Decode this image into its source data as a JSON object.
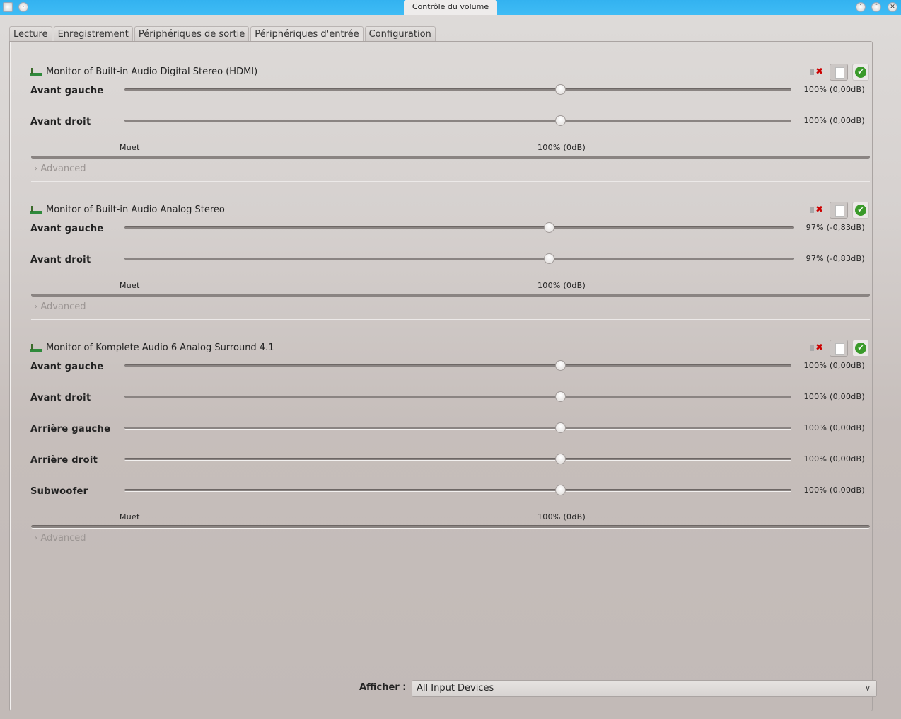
{
  "window": {
    "title": "Contrôle du volume"
  },
  "tabs": [
    {
      "label": "Lecture"
    },
    {
      "label": "Enregistrement"
    },
    {
      "label": "Périphériques de sortie"
    },
    {
      "label": "Périphériques d'entrée",
      "active": true
    },
    {
      "label": "Configuration"
    }
  ],
  "devices": [
    {
      "name": "Monitor of Built-in Audio Digital Stereo (HDMI)",
      "channels": [
        {
          "label": "Avant gauche",
          "percent": 100,
          "value": "100% (0,00dB)"
        },
        {
          "label": "Avant droit",
          "percent": 100,
          "value": "100% (0,00dB)"
        }
      ],
      "scale_min": "Muet",
      "scale_mid": "100% (0dB)",
      "advanced": "Advanced"
    },
    {
      "name": "Monitor of Built-in Audio Analog Stereo",
      "channels": [
        {
          "label": "Avant gauche",
          "percent": 97,
          "value": "97% (-0,83dB)"
        },
        {
          "label": "Avant droit",
          "percent": 97,
          "value": "97% (-0,83dB)"
        }
      ],
      "scale_min": "Muet",
      "scale_mid": "100% (0dB)",
      "advanced": "Advanced"
    },
    {
      "name": "Monitor of Komplete Audio 6 Analog Surround 4.1",
      "channels": [
        {
          "label": "Avant gauche",
          "percent": 100,
          "value": "100% (0,00dB)"
        },
        {
          "label": "Avant droit",
          "percent": 100,
          "value": "100% (0,00dB)"
        },
        {
          "label": "Arrière gauche",
          "percent": 100,
          "value": "100% (0,00dB)"
        },
        {
          "label": "Arrière droit",
          "percent": 100,
          "value": "100% (0,00dB)"
        },
        {
          "label": "Subwoofer",
          "percent": 100,
          "value": "100% (0,00dB)"
        }
      ],
      "scale_min": "Muet",
      "scale_mid": "100% (0dB)",
      "advanced": "Advanced"
    }
  ],
  "slider_max_percent": 153,
  "footer": {
    "show_label": "Afficher :",
    "show_value": "All Input Devices"
  }
}
